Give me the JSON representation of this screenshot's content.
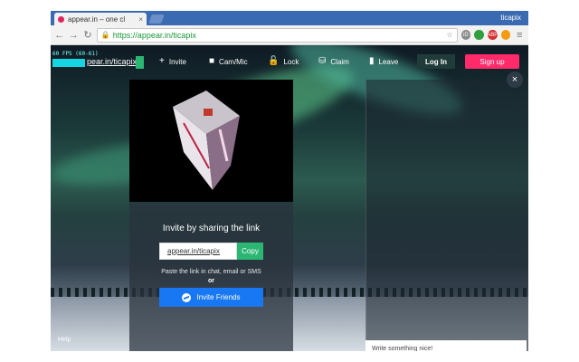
{
  "browser": {
    "tab_title": "appear.in – one cl",
    "tab_close": "×",
    "profile_name": "ticapix",
    "url": "https://appear.in/ticapix",
    "nav": {
      "back": "←",
      "forward": "→",
      "reload": "↻"
    },
    "omnibox_icons": [
      "☆",
      "⋮"
    ],
    "extensions": [
      {
        "name": "id-extension",
        "label": "iD",
        "color": "#8a8a8a"
      },
      {
        "name": "chrome-extension",
        "label": "",
        "color": "#2f9f3f"
      },
      {
        "name": "abp-extension",
        "label": "ABP",
        "color": "#d32f2f"
      },
      {
        "name": "orange-extension",
        "label": "",
        "color": "#f39c12"
      }
    ],
    "menu_label": "≡"
  },
  "app": {
    "fps": "60 FPS (60-61)",
    "room_name": "pear.in/ticapix",
    "nav": [
      {
        "name": "invite",
        "icon": "+",
        "label": "Invite"
      },
      {
        "name": "cam-mic",
        "icon": "■",
        "label": "Cam/Mic"
      },
      {
        "name": "lock",
        "icon": "🔓",
        "label": "Lock"
      },
      {
        "name": "claim",
        "icon": "⛁",
        "label": "Claim"
      },
      {
        "name": "leave",
        "icon": "▮",
        "label": "Leave"
      }
    ],
    "login_label": "Log In",
    "signup_label": "Sign up",
    "invite": {
      "title": "Invite by sharing the link",
      "link": "appear.in/ticapix",
      "copy_label": "Copy",
      "paste_text": "Paste the link in chat, email or SMS",
      "or_text": "or",
      "friends_label": "Invite Friends"
    },
    "chat": {
      "close_label": "×",
      "input_placeholder": "Write something nice!"
    },
    "help_label": "Help"
  },
  "colors": {
    "brand_pink": "#ff2a6a",
    "copy_green": "#2bb673",
    "messenger_blue": "#1877f2",
    "room_cyan": "#15d6e0"
  }
}
